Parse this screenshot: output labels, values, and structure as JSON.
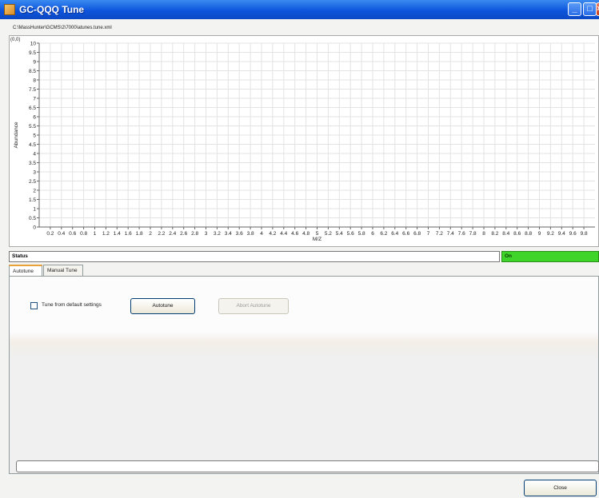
{
  "window": {
    "title": "GC-QQQ Tune"
  },
  "file_path": "C:\\MassHunter\\GCMS\\2\\7000\\atunes.tune.xml",
  "plot": {
    "origin_label": "(0,0)",
    "xlabel": "M/Z",
    "ylabel": "Abundance",
    "xlim": [
      0,
      10
    ],
    "ylim": [
      0,
      10
    ],
    "x_ticks": [
      "0.2",
      "0.4",
      "0.6",
      "0.8",
      "1",
      "1.2",
      "1.4",
      "1.6",
      "1.8",
      "2",
      "2.2",
      "2.4",
      "2.6",
      "2.8",
      "3",
      "3.2",
      "3.4",
      "3.6",
      "3.8",
      "4",
      "4.2",
      "4.4",
      "4.6",
      "4.8",
      "5",
      "5.2",
      "5.4",
      "5.6",
      "5.8",
      "6",
      "6.2",
      "6.4",
      "6.6",
      "6.8",
      "7",
      "7.2",
      "7.4",
      "7.6",
      "7.8",
      "8",
      "8.2",
      "8.4",
      "8.6",
      "8.8",
      "9",
      "9.2",
      "9.4",
      "9.6",
      "9.8"
    ],
    "y_ticks": [
      "0",
      "0.5",
      "1",
      "1.5",
      "2",
      "2.5",
      "3",
      "3.5",
      "4",
      "4.5",
      "5",
      "5.5",
      "6",
      "6.5",
      "7",
      "7.5",
      "8",
      "8.5",
      "9",
      "9.5",
      "10"
    ],
    "grid": true
  },
  "status": {
    "label": "Status",
    "value": "On",
    "value_color": "#3fd42a"
  },
  "tabs": [
    {
      "label": "Autotune",
      "active": true
    },
    {
      "label": "Manual Tune",
      "active": false
    }
  ],
  "autotune_panel": {
    "checkbox_label": "Tune from default settings",
    "checkbox_checked": false,
    "autotune_button": "Autotune",
    "abort_button": "Abort Autotune"
  },
  "progress": 0,
  "close_button": "Close",
  "icons": {
    "app": "app-icon",
    "minimize": "minimize-icon",
    "maximize": "maximize-icon",
    "close": "close-icon"
  }
}
